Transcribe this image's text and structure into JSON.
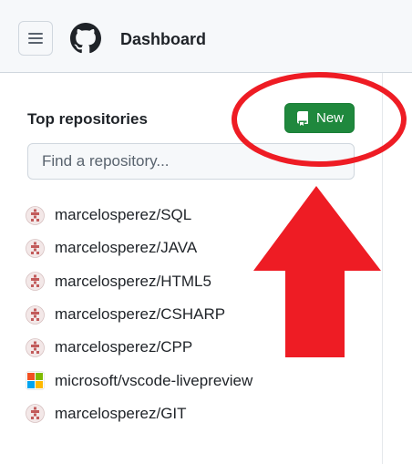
{
  "header": {
    "title": "Dashboard",
    "menu_icon": "hamburger-icon",
    "logo_icon": "github-logo"
  },
  "sidebar": {
    "section_title": "Top repositories",
    "new_button": {
      "label": "New",
      "icon": "repo-icon",
      "color": "#1f883d"
    },
    "search": {
      "placeholder": "Find a repository...",
      "value": ""
    },
    "repos": [
      {
        "name": "marcelosperez/SQL",
        "avatar": "identicon"
      },
      {
        "name": "marcelosperez/JAVA",
        "avatar": "identicon"
      },
      {
        "name": "marcelosperez/HTML5",
        "avatar": "identicon"
      },
      {
        "name": "marcelosperez/CSHARP",
        "avatar": "identicon"
      },
      {
        "name": "marcelosperez/CPP",
        "avatar": "identicon"
      },
      {
        "name": "microsoft/vscode-livepreview",
        "avatar": "microsoft-logo"
      },
      {
        "name": "marcelosperez/GIT",
        "avatar": "identicon"
      }
    ]
  },
  "annotation": {
    "color": "#ee1c24",
    "shapes": [
      "ellipse-around-new-button",
      "up-arrow"
    ]
  }
}
